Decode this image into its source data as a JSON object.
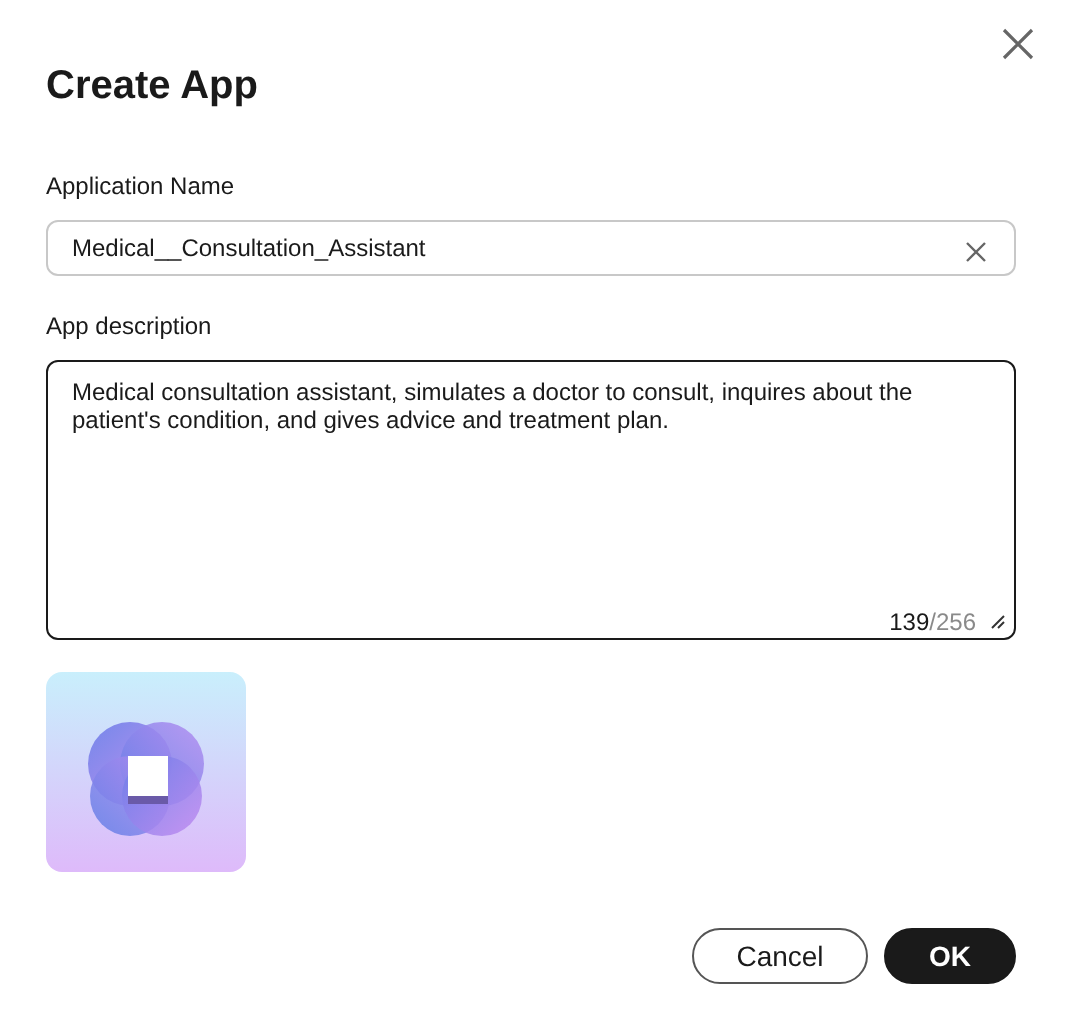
{
  "dialog": {
    "title": "Create App"
  },
  "name_field": {
    "label": "Application Name",
    "value": "Medical__Consultation_Assistant"
  },
  "description_field": {
    "label": "App description",
    "value": "Medical consultation assistant, simulates a doctor to consult, inquires about the patient's condition, and gives advice and treatment plan.",
    "count": "139",
    "limit": "/256"
  },
  "buttons": [
    {
      "label": "Cancel",
      "kind": "secondary"
    },
    {
      "label": "OK",
      "kind": "primary"
    }
  ]
}
